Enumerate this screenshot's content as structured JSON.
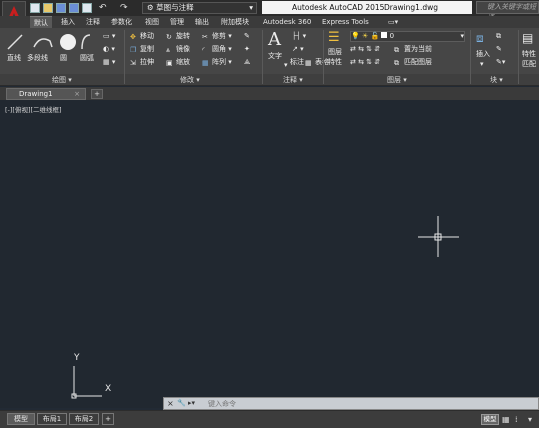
{
  "titlebar": {
    "app_name": "Autodesk AutoCAD 2015",
    "file_name": "Drawing1.dwg",
    "workspace": "草图与注释",
    "search_placeholder": "键入关键字或短语"
  },
  "tabs": [
    "默认",
    "插入",
    "注释",
    "参数化",
    "视图",
    "管理",
    "输出",
    "附加模块",
    "Autodesk 360",
    "Express Tools"
  ],
  "active_tab": "默认",
  "ribbon": {
    "draw": {
      "title": "绘图",
      "line": "直线",
      "polyline": "多段线",
      "circle": "圆",
      "arc": "圆弧"
    },
    "modify": {
      "title": "修改",
      "move": "移动",
      "rotate": "旋转",
      "trim": "修剪",
      "copy": "复制",
      "mirror": "镜像",
      "fillet": "圆角",
      "stretch": "拉伸",
      "scale": "缩放",
      "array": "阵列"
    },
    "annotation": {
      "title": "注释",
      "text": "文字",
      "dimension": "标注",
      "table": "表格"
    },
    "layers": {
      "title": "图层",
      "properties_1": "图层",
      "properties_2": "特性",
      "current_layer": "0",
      "make_current": "置为当前",
      "match_layer": "匹配图层"
    },
    "block": {
      "title": "块",
      "insert": "插入"
    },
    "properties": {
      "prop_1": "特性",
      "prop_2": "匹配"
    }
  },
  "document_tab": "Drawing1",
  "view_control": "[-][俯视][二维线框]",
  "ucs": {
    "x": "X",
    "y": "Y"
  },
  "command_line": {
    "placeholder": "键入命令"
  },
  "layout_tabs": [
    "模型",
    "布局1",
    "布局2"
  ],
  "status": {
    "model": "模型"
  },
  "colors": {
    "canvas": "#212830",
    "ribbon": "#464646",
    "app_red": "#c81e1e"
  }
}
